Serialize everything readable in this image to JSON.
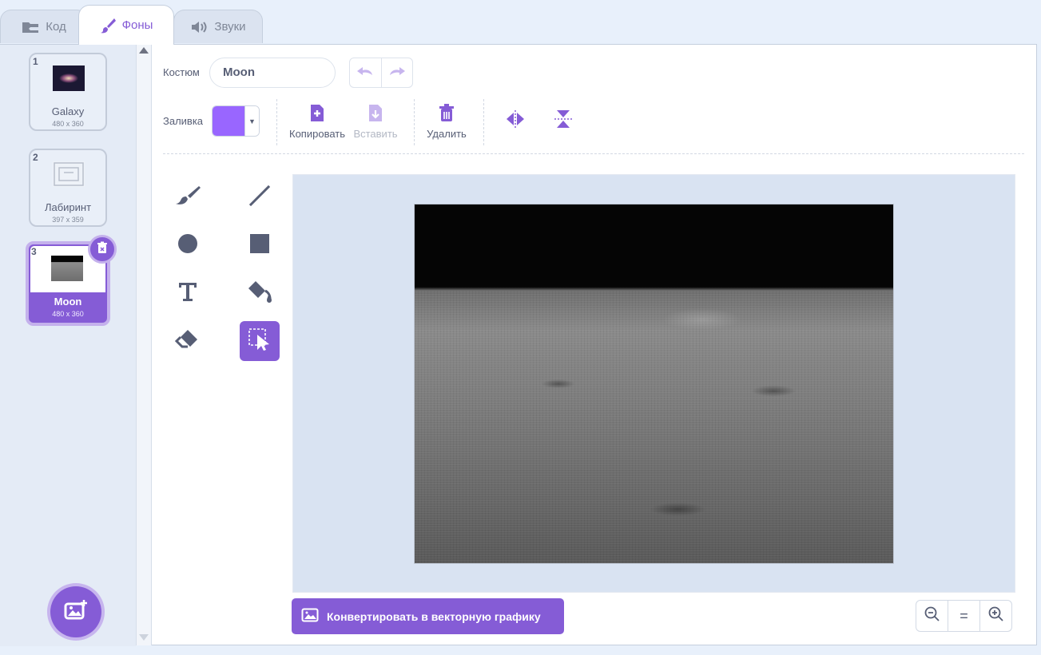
{
  "tabs": [
    {
      "label": "Код",
      "icon": "code-icon"
    },
    {
      "label": "Фоны",
      "icon": "paintbrush-icon",
      "active": true
    },
    {
      "label": "Звуки",
      "icon": "speaker-icon"
    }
  ],
  "costumes": [
    {
      "num": "1",
      "name": "Galaxy",
      "size": "480 x 360"
    },
    {
      "num": "2",
      "name": "Лабиринт",
      "size": "397 x 359"
    },
    {
      "num": "3",
      "name": "Moon",
      "size": "480 x 360",
      "selected": true
    }
  ],
  "editor": {
    "costume_label": "Костюм",
    "costume_name": "Moon",
    "fill_label": "Заливка",
    "fill_color": "#9966ff",
    "copy_label": "Копировать",
    "paste_label": "Вставить",
    "delete_label": "Удалить",
    "convert_label": "Конвертировать в векторную графику",
    "zoom_reset": "="
  },
  "colors": {
    "accent": "#855cd6",
    "accent_light": "#c4b1ec"
  }
}
